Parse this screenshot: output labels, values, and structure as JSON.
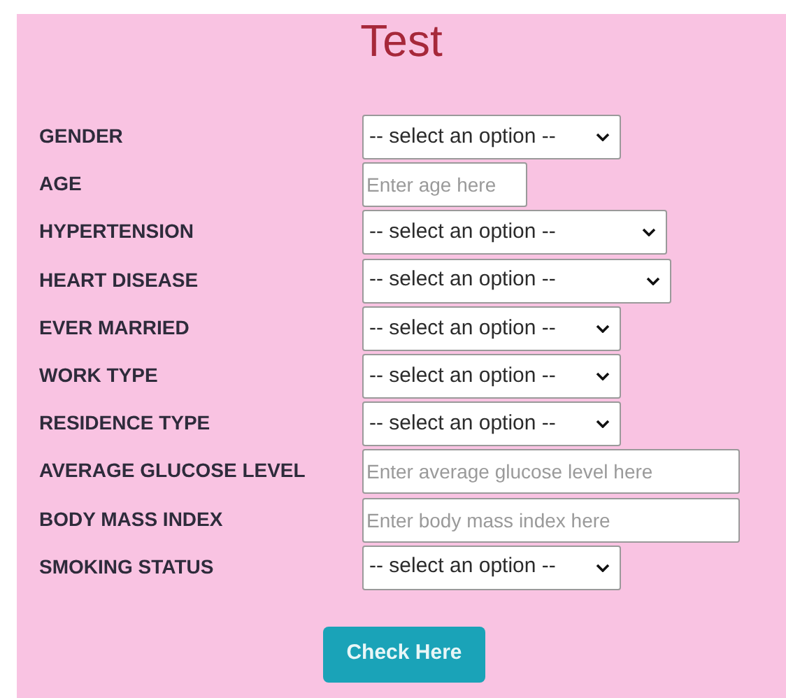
{
  "title": "Test",
  "fields": [
    {
      "label": "GENDER",
      "kind": "select",
      "value": "-- select an option --"
    },
    {
      "label": "AGE",
      "kind": "input",
      "placeholder": "Enter age here"
    },
    {
      "label": "HYPERTENSION",
      "kind": "select",
      "value": "-- select an option --"
    },
    {
      "label": "HEART DISEASE",
      "kind": "select",
      "value": "-- select an option --"
    },
    {
      "label": "EVER MARRIED",
      "kind": "select",
      "value": "-- select an option --"
    },
    {
      "label": "WORK TYPE",
      "kind": "select",
      "value": "-- select an option --"
    },
    {
      "label": "RESIDENCE TYPE",
      "kind": "select",
      "value": "-- select an option --"
    },
    {
      "label": "AVERAGE GLUCOSE LEVEL",
      "kind": "input",
      "placeholder": "Enter average glucose level here"
    },
    {
      "label": "BODY MASS INDEX",
      "kind": "input",
      "placeholder": "Enter body mass index here"
    },
    {
      "label": "SMOKING STATUS",
      "kind": "select",
      "value": "-- select an option --"
    }
  ],
  "button": "Check Here"
}
